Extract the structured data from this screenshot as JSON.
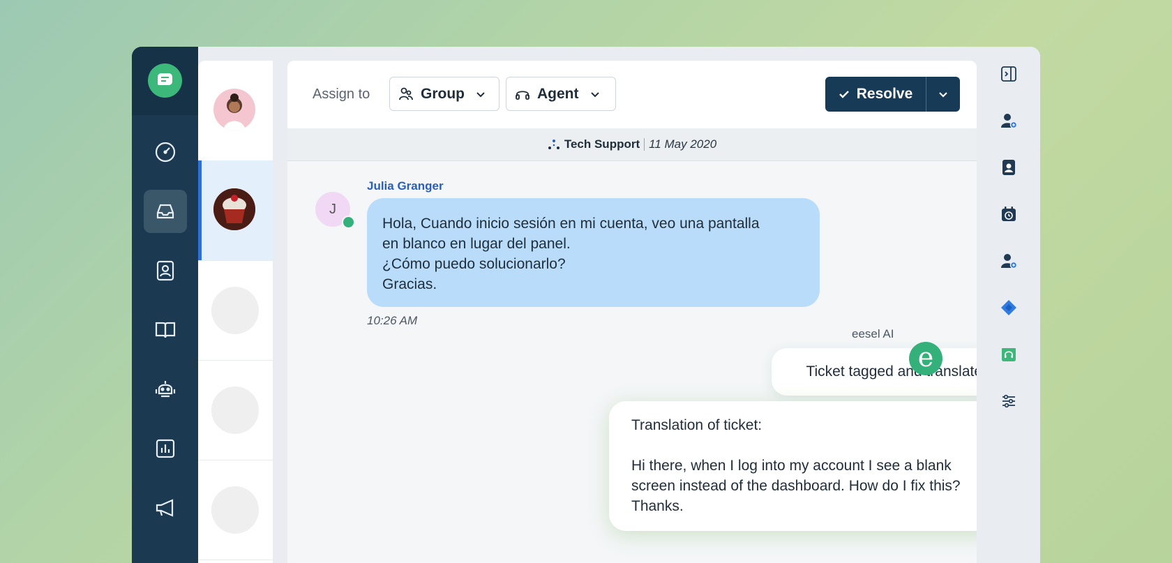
{
  "toolbar": {
    "assign_label": "Assign to",
    "group_label": "Group",
    "agent_label": "Agent",
    "resolve_label": "Resolve"
  },
  "conversation": {
    "group": "Tech Support",
    "date": "11 May 2020",
    "customer": {
      "name": "Julia Granger",
      "initial": "J",
      "message_lines": [
        "Hola, Cuando inicio sesión en mi cuenta, veo una pantalla",
        "en blanco en lugar del panel.",
        "¿Cómo puedo solucionarlo?",
        "Gracias."
      ],
      "time": "10:26 AM"
    },
    "ai": {
      "name": "eesel AI",
      "avatar_letter": "e",
      "status_message": "Ticket tagged and translated.",
      "translation_lines": [
        "Translation of ticket:",
        "",
        "Hi there, when I log into my account I see a blank",
        "screen instead of the dashboard. How do I fix this?",
        "Thanks."
      ]
    }
  },
  "colors": {
    "nav_bg": "#1b3a52",
    "brand_green": "#3cb87a",
    "resolve_bg": "#173a57",
    "customer_bubble": "#b9dcfb",
    "sender_name": "#2a5fb8"
  },
  "icons": {
    "nav": [
      "dashboard-icon",
      "inbox-icon",
      "contacts-icon",
      "knowledge-base-icon",
      "bot-icon",
      "reports-icon",
      "campaigns-icon"
    ],
    "rail": [
      "collapse-panel-icon",
      "assign-user-icon",
      "contact-card-icon",
      "schedule-icon",
      "add-user-icon",
      "jira-icon",
      "support-headset-icon",
      "settings-sliders-icon"
    ]
  }
}
